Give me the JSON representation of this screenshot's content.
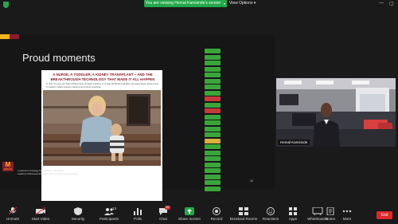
{
  "topbar": {
    "banner_text": "You are viewing Hemal Kamsinde's screen",
    "view_options": "View Options ▾",
    "window_controls": [
      "—",
      "▢"
    ]
  },
  "slide": {
    "title": "Proud moments",
    "article_headline": "A NURSE, A TODDLER, A KIDNEY TRANSPLANT – AND THE BREAKTHROUGH TECHNOLOGY THAT MADE IT ALL HAPPEN",
    "article_subtext": "In July, 27-year-old Taylor Abbruzzese donated a kidney to 3-year-old Bodie Hall after she was paired using a new innovation called epitope mapping and hybrid matching.",
    "footer_lines": [
      "A statement of strategy for University of Minnesota",
      "Academy of Minnesota Educators and Community Health Services"
    ],
    "logo_mark": "M",
    "logo_text": "HEALTH",
    "page_number": "11",
    "tag_colors": [
      "#3aa63a",
      "#3aa63a",
      "#3aa63a",
      "#3aa63a",
      "#3aa63a",
      "#3aa63a",
      "#3aa63a",
      "#3aa63a",
      "#c83a3a",
      "#3aa63a",
      "#c83a3a",
      "#3aa63a",
      "#3aa63a",
      "#3aa63a",
      "#3aa63a",
      "#d6b23a",
      "#3aa63a",
      "#3aa63a",
      "#3aa63a",
      "#3aa63a",
      "#3aa63a",
      "#3aa63a",
      "#3aa63a",
      "#3aa63a"
    ]
  },
  "video": {
    "name": "Hemal Kamsinde"
  },
  "toolbar": {
    "items": [
      {
        "label": "Unmute"
      },
      {
        "label": "Start Video"
      },
      {
        "label": "Security"
      },
      {
        "label": "Participants",
        "count": "14"
      },
      {
        "label": "Polls"
      },
      {
        "label": "Chat",
        "badge": "20"
      },
      {
        "label": "Share Screen"
      },
      {
        "label": "Record"
      },
      {
        "label": "Breakout Rooms"
      },
      {
        "label": "Reactions"
      },
      {
        "label": "Apps"
      },
      {
        "label": "Whiteboards"
      },
      {
        "label": "Notes"
      },
      {
        "label": "More"
      }
    ],
    "end_label": "End"
  },
  "colors": {
    "accent_green": "#23a84a",
    "end_red": "#e02828",
    "maroon": "#8a1c2b",
    "gold": "#f4b61a"
  }
}
